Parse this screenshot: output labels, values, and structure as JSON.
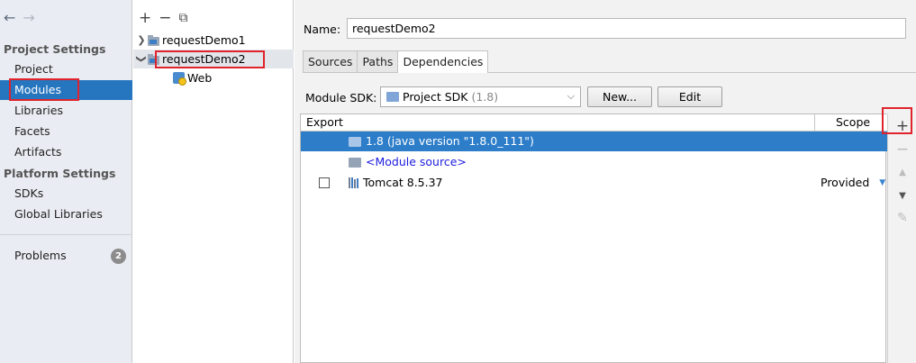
{
  "sidebar": {
    "nav_back": "←",
    "nav_forward": "→",
    "project_settings_header": "Project Settings",
    "platform_settings_header": "Platform Settings",
    "items": {
      "project": "Project",
      "modules": "Modules",
      "libraries": "Libraries",
      "facets": "Facets",
      "artifacts": "Artifacts",
      "sdks": "SDKs",
      "global_libraries": "Global Libraries",
      "problems": "Problems"
    },
    "problems_count": "2",
    "selected": "Modules"
  },
  "tree": {
    "toolbar": {
      "add": "+",
      "remove": "−",
      "copy": "⧉"
    },
    "modules": [
      {
        "label": "requestDemo1",
        "expanded": false
      },
      {
        "label": "requestDemo2",
        "expanded": true,
        "selected": true
      }
    ],
    "facet": "Web"
  },
  "main": {
    "name_label": "Name:",
    "name_value": "requestDemo2",
    "tabs": [
      "Sources",
      "Paths",
      "Dependencies"
    ],
    "active_tab": "Dependencies",
    "sdk_label": "Module SDK:",
    "sdk_value": "Project SDK",
    "sdk_version": "(1.8)",
    "new_button": "New...",
    "edit_button": "Edit"
  },
  "dependencies": {
    "col_export": "Export",
    "col_scope": "Scope",
    "rows": [
      {
        "name": "1.8 (java version \"1.8.0_111\")",
        "scope": "",
        "selected": true
      },
      {
        "name": "<Module source>",
        "scope": ""
      },
      {
        "name": "Tomcat 8.5.37",
        "scope": "Provided",
        "exported": false
      }
    ]
  },
  "actions": {
    "add": "+",
    "remove": "−",
    "up": "▲",
    "down": "▼",
    "edit": "✎"
  },
  "colors": {
    "selection": "#2675bf",
    "highlight_box": "#e0232c",
    "link": "#1c1ce0"
  }
}
